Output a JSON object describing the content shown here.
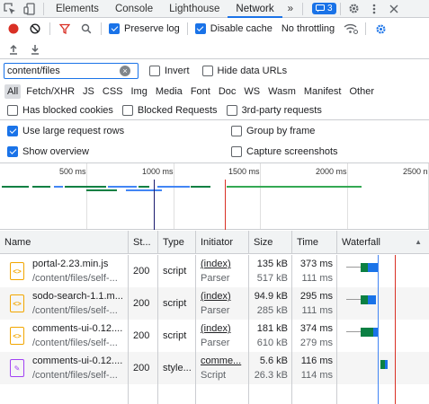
{
  "tabs": [
    "Elements",
    "Console",
    "Lighthouse",
    "Network"
  ],
  "active_tab": "Network",
  "more_tabs": "»",
  "issues_count": "3",
  "toolbar": {
    "preserve_log": "Preserve log",
    "disable_cache": "Disable cache",
    "throttling": "No throttling"
  },
  "filter": {
    "value": "content/files",
    "invert": "Invert",
    "hide_data_urls": "Hide data URLs"
  },
  "type_filters": [
    "All",
    "Fetch/XHR",
    "JS",
    "CSS",
    "Img",
    "Media",
    "Font",
    "Doc",
    "WS",
    "Wasm",
    "Manifest",
    "Other"
  ],
  "blocked": {
    "has_blocked_cookies": "Has blocked cookies",
    "blocked_requests": "Blocked Requests",
    "third_party": "3rd-party requests"
  },
  "options": {
    "large_rows": "Use large request rows",
    "group_by_frame": "Group by frame",
    "show_overview": "Show overview",
    "capture_screenshots": "Capture screenshots"
  },
  "overview": {
    "ticks": [
      "500 ms",
      "1000 ms",
      "1500 ms",
      "2000 ms",
      "2500 n"
    ]
  },
  "columns": {
    "name": "Name",
    "status": "St...",
    "type": "Type",
    "initiator": "Initiator",
    "size": "Size",
    "time": "Time",
    "waterfall": "Waterfall"
  },
  "requests": [
    {
      "icon": "js",
      "name": "portal-2.23.min.js",
      "path": "/content/files/self-...",
      "status": "200",
      "type": "script",
      "initiator": "(index)",
      "initiator_sub": "Parser",
      "size": "135 kB",
      "size_sub": "517 kB",
      "time": "373 ms",
      "time_sub": "111 ms"
    },
    {
      "icon": "js",
      "name": "sodo-search-1.1.m...",
      "path": "/content/files/self-...",
      "status": "200",
      "type": "script",
      "initiator": "(index)",
      "initiator_sub": "Parser",
      "size": "94.9 kB",
      "size_sub": "285 kB",
      "time": "295 ms",
      "time_sub": "111 ms"
    },
    {
      "icon": "js",
      "name": "comments-ui-0.12....",
      "path": "/content/files/self-...",
      "status": "200",
      "type": "script",
      "initiator": "(index)",
      "initiator_sub": "Parser",
      "size": "181 kB",
      "size_sub": "610 kB",
      "time": "374 ms",
      "time_sub": "279 ms"
    },
    {
      "icon": "css",
      "name": "comments-ui-0.12....",
      "path": "/content/files/self-...",
      "status": "200",
      "type": "style...",
      "initiator": "comme...",
      "initiator_sub": "Script",
      "size": "5.6 kB",
      "size_sub": "26.3 kB",
      "time": "116 ms",
      "time_sub": "114 ms"
    }
  ]
}
